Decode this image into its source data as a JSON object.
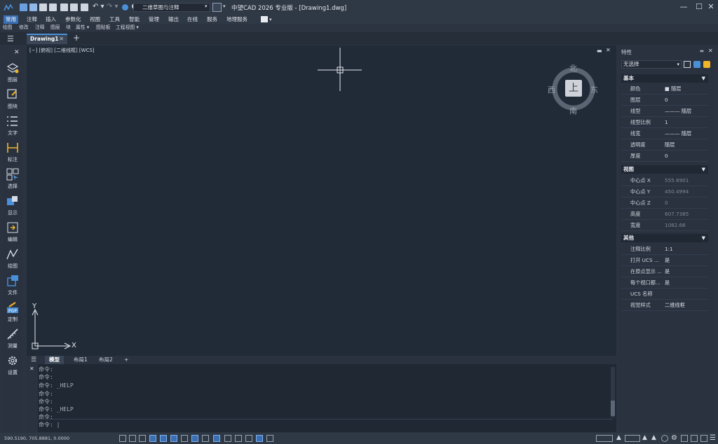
{
  "app": {
    "title": "中望CAD 2026 专业版 - [Drawing1.dwg]",
    "workspace": "二维草图与注释"
  },
  "menu": [
    "常用",
    "注释",
    "插入",
    "参数化",
    "视图",
    "工具",
    "智能",
    "管理",
    "输出",
    "在线",
    "服务",
    "地理服务"
  ],
  "toolbar2": [
    "绘图",
    "修改",
    "注释",
    "图层",
    "块",
    "属性 ▾",
    "图贴板",
    "工程视图 ▾"
  ],
  "document_tab": "Drawing1",
  "viewport_label": "[−] [俯视] [二维线框] [WCS]",
  "viewcube": {
    "north": "北",
    "south": "南",
    "west": "西",
    "east": "东",
    "top": "上"
  },
  "left_tools": [
    "图层",
    "图块",
    "文字",
    "标注",
    "选择",
    "显示",
    "编辑",
    "绘图",
    "文件",
    "定制",
    "测量",
    "设置"
  ],
  "ucs": {
    "x": "X",
    "y": "Y"
  },
  "layout_tabs": [
    "模型",
    "布局1",
    "布局2",
    "+"
  ],
  "command_lines": [
    "命令:",
    "命令:",
    "命令: _HELP",
    "命令:",
    "命令:",
    "命令: _HELP",
    "命令:"
  ],
  "command_prompt": "命令: |",
  "status": {
    "coords": "590.5190, 705.8881, 0.0000"
  },
  "properties": {
    "title": "特性",
    "selection": "无选择",
    "sections": {
      "basic": {
        "label": "基本",
        "rows": [
          {
            "k": "颜色",
            "v": "■ 随层"
          },
          {
            "k": "图层",
            "v": "0"
          },
          {
            "k": "线型",
            "v": "——— 随层"
          },
          {
            "k": "线型比例",
            "v": "1"
          },
          {
            "k": "线宽",
            "v": "——— 随层"
          },
          {
            "k": "透明度",
            "v": "随层"
          },
          {
            "k": "厚度",
            "v": "0"
          }
        ]
      },
      "view": {
        "label": "视图",
        "rows": [
          {
            "k": "中心点 X",
            "v": "555.8901"
          },
          {
            "k": "中心点 Y",
            "v": "450.4994"
          },
          {
            "k": "中心点 Z",
            "v": "0"
          },
          {
            "k": "高度",
            "v": "607.7385"
          },
          {
            "k": "宽度",
            "v": "1082.66"
          }
        ]
      },
      "misc": {
        "label": "其他",
        "rows": [
          {
            "k": "注释比例",
            "v": "1:1"
          },
          {
            "k": "打开 UCS ...",
            "v": "是"
          },
          {
            "k": "在原点显示 ...",
            "v": "是"
          },
          {
            "k": "每个视口都...",
            "v": "是"
          },
          {
            "k": "UCS 名称",
            "v": ""
          },
          {
            "k": "视觉样式",
            "v": "二维线框"
          }
        ]
      }
    }
  },
  "colors": {
    "accent": "#3b6fb3",
    "canvas": "#212b38",
    "panel": "#2a3240"
  }
}
